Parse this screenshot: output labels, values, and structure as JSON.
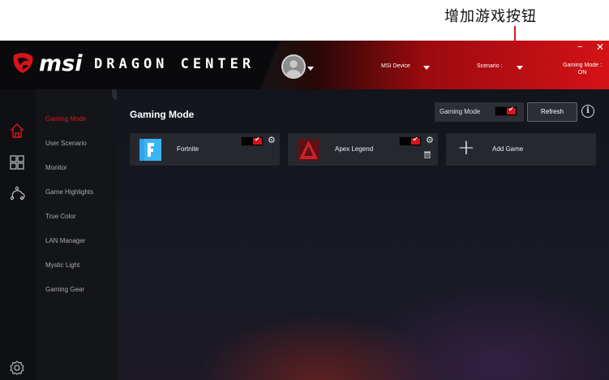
{
  "annotation": {
    "text": "增加游戏按钮"
  },
  "header": {
    "brand_msi": "msi",
    "brand_title": "DRAGON CENTER",
    "device_label": "MSI Device",
    "scenario_label": "Scenario :",
    "gaming_mode_label": "Gaming Mode :",
    "gaming_mode_value": "ON",
    "minimize": "–",
    "close": "✕"
  },
  "sidebar": {
    "items": [
      {
        "label": "Gaming Mode",
        "active": true
      },
      {
        "label": "User Scenario"
      },
      {
        "label": "Monitor"
      },
      {
        "label": "Game Highlights"
      },
      {
        "label": "True Color"
      },
      {
        "label": "LAN Manager"
      },
      {
        "label": "Mystic Light"
      },
      {
        "label": "Gaming Gear"
      }
    ],
    "icons": [
      "home-icon",
      "apps-grid-icon",
      "cloud-sync-icon",
      "settings-gear-icon"
    ]
  },
  "main": {
    "title": "Gaming Mode",
    "gaming_mode_toggle_label": "Gaming Mode",
    "gaming_mode_on": true,
    "refresh_label": "Refresh",
    "info_glyph": "i",
    "games": [
      {
        "name": "Fortnite",
        "enabled": true,
        "icon": "fortnite-icon",
        "color": "#2fa2e8"
      },
      {
        "name": "Apex Legend",
        "enabled": true,
        "icon": "apex-legends-icon",
        "color": "#c8232a"
      }
    ],
    "add_game_label": "Add Game"
  },
  "colors": {
    "accent": "#d8131a",
    "card": "#262830",
    "header_red": "#d41217"
  }
}
